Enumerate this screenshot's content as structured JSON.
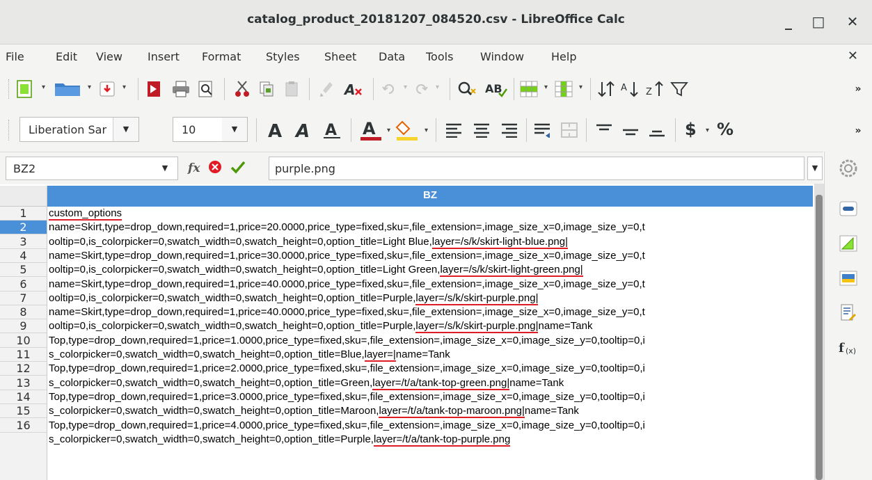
{
  "window": {
    "title": "catalog_product_20181207_084520.csv - LibreOffice Calc",
    "minimize": "_",
    "maximize": "□",
    "close": "✕"
  },
  "menu": {
    "items": [
      "File",
      "Edit",
      "View",
      "Insert",
      "Format",
      "Styles",
      "Sheet",
      "Data",
      "Tools",
      "Window",
      "Help"
    ],
    "close": "✕"
  },
  "format_toolbar": {
    "font_name": "Liberation Sar",
    "font_size": "10",
    "currency_label": "$",
    "percent_label": "%"
  },
  "formula_bar": {
    "cell_reference": "BZ2",
    "fx_label": "fx",
    "cell_content": "purple.png"
  },
  "sheet": {
    "column_header": "BZ",
    "selected_row": 2,
    "row_numbers": [
      "1",
      "2",
      "3",
      "4",
      "5",
      "6",
      "7",
      "8",
      "9",
      "10",
      "11",
      "12",
      "13",
      "14",
      "15",
      "16"
    ],
    "lines": [
      "custom_options",
      "name=Skirt,type=drop_down,required=1,price=20.0000,price_type=fixed,sku=,file_extension=,image_size_x=0,image_size_y=0,t",
      "ooltip=0,is_colorpicker=0,swatch_width=0,swatch_height=0,option_title=Light Blue,layer=/s/k/skirt-light-blue.png|",
      "name=Skirt,type=drop_down,required=1,price=30.0000,price_type=fixed,sku=,file_extension=,image_size_x=0,image_size_y=0,t",
      "ooltip=0,is_colorpicker=0,swatch_width=0,swatch_height=0,option_title=Light Green,layer=/s/k/skirt-light-green.png|",
      "name=Skirt,type=drop_down,required=1,price=40.0000,price_type=fixed,sku=,file_extension=,image_size_x=0,image_size_y=0,t",
      "ooltip=0,is_colorpicker=0,swatch_width=0,swatch_height=0,option_title=Purple,layer=/s/k/skirt-purple.png|",
      "name=Skirt,type=drop_down,required=1,price=40.0000,price_type=fixed,sku=,file_extension=,image_size_x=0,image_size_y=0,t",
      "ooltip=0,is_colorpicker=0,swatch_width=0,swatch_height=0,option_title=Purple,layer=/s/k/skirt-purple.png|name=Tank",
      "Top,type=drop_down,required=1,price=1.0000,price_type=fixed,sku=,file_extension=,image_size_x=0,image_size_y=0,tooltip=0,i",
      "s_colorpicker=0,swatch_width=0,swatch_height=0,option_title=Blue,layer=|name=Tank",
      "Top,type=drop_down,required=1,price=2.0000,price_type=fixed,sku=,file_extension=,image_size_x=0,image_size_y=0,tooltip=0,i",
      "s_colorpicker=0,swatch_width=0,swatch_height=0,option_title=Green,layer=/t/a/tank-top-green.png|name=Tank",
      "Top,type=drop_down,required=1,price=3.0000,price_type=fixed,sku=,file_extension=,image_size_x=0,image_size_y=0,tooltip=0,i",
      "s_colorpicker=0,swatch_width=0,swatch_height=0,option_title=Maroon,layer=/t/a/tank-top-maroon.png|name=Tank",
      "Top,type=drop_down,required=1,price=4.0000,price_type=fixed,sku=,file_extension=,image_size_x=0,image_size_y=0,tooltip=0,i",
      "s_colorpicker=0,swatch_width=0,swatch_height=0,option_title=Purple,layer=/t/a/tank-top-purple.png"
    ]
  },
  "colors": {
    "selection": "#4a90d9",
    "annotation": "#e01b24"
  }
}
